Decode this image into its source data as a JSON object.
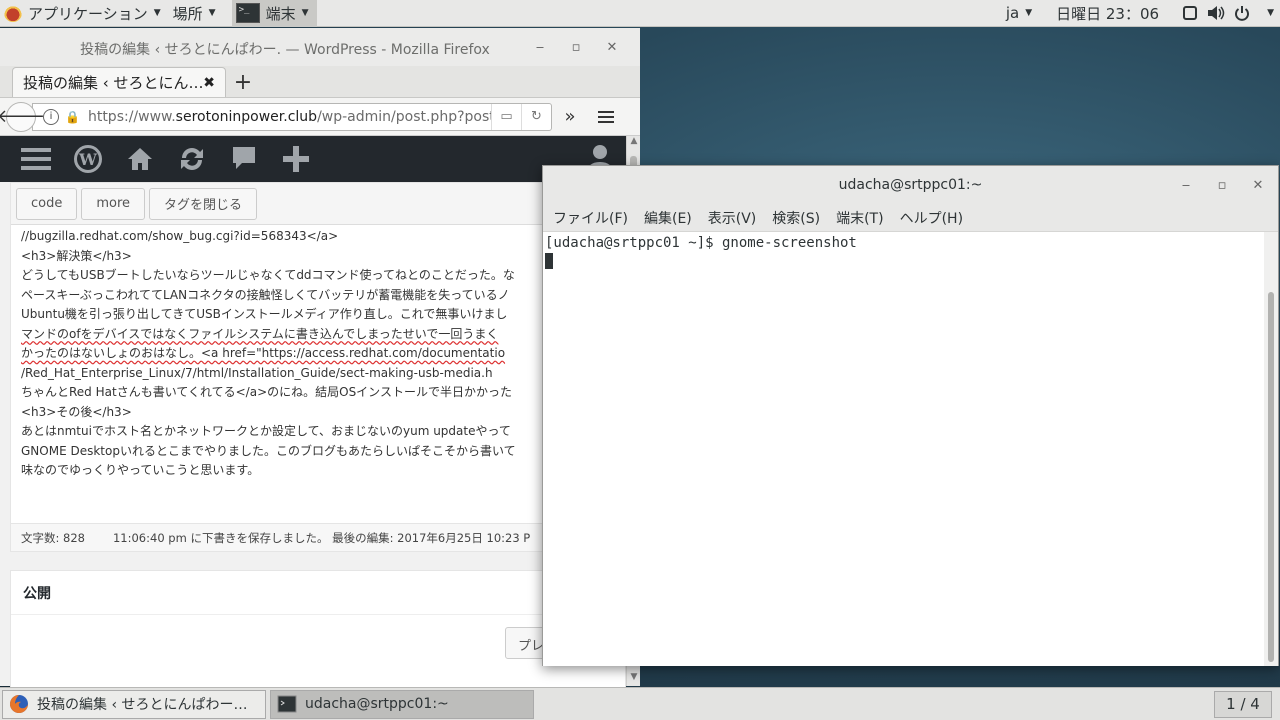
{
  "topbar": {
    "applications": "アプリケーション",
    "places": "場所",
    "active_app": "端末",
    "input_method": "ja",
    "clock": "日曜日 23：06"
  },
  "firefox": {
    "window_title": "投稿の編集 ‹ せろとにんぱわー. — WordPress - Mozilla Firefox",
    "tab_label": "投稿の編集 ‹ せろとにん…",
    "url_prefix": "https://www.",
    "url_domain": "serotoninpower.club",
    "url_path": "/wp-admin/post.php?post"
  },
  "editor": {
    "buttons": [
      "code",
      "more",
      "タグを閉じる"
    ],
    "lines": [
      "//bugzilla.redhat.com/show_bug.cgi?id=568343</a>",
      "<h3>解決策</h3>",
      "どうしてもUSBブートしたいならツールじゃなくてddコマンド使ってねとのことだった。な",
      "ペースキーぶっこわれててLANコネクタの接触怪しくてバッテリが蓄電機能を失っているノ",
      "Ubuntu機を引っ張り出してきてUSBインストールメディア作り直し。これで無事いけまし",
      "マンドのofをデバイスではなくファイルシステムに書き込んでしまったせいで一回うまく",
      "かったのはないしょのおはなし。<a href=\"https://access.redhat.com/documentatio",
      "/Red_Hat_Enterprise_Linux/7/html/Installation_Guide/sect-making-usb-media.h",
      "ちゃんとRed Hatさんも書いてくれてる</a>のにね。結局OSインストールで半日かかった",
      "<h3>その後</h3>",
      "あとはnmtuiでホスト名とかネットワークとか設定して、おまじないのyum updateやって",
      "GNOME Desktopいれるとこまでやりました。このブログもあたらしいぱそこそから書いて",
      "味なのでゆっくりやっていこうと思います。"
    ],
    "word_count": "文字数: 828",
    "save_status": "11:06:40 pm に下書きを保存しました。 最後の編集: 2017年6月25日 10:23 P",
    "publish_title": "公開",
    "preview_label": "プレ"
  },
  "terminal": {
    "title": "udacha@srtppc01:~",
    "menus": [
      "ファイル(F)",
      "編集(E)",
      "表示(V)",
      "検索(S)",
      "端末(T)",
      "ヘルプ(H)"
    ],
    "prompt": "[udacha@srtppc01 ~]$ gnome-screenshot"
  },
  "taskbar": {
    "tasks": [
      "投稿の編集 ‹ せろとにんぱわー…",
      "udacha@srtppc01:~"
    ],
    "workspace": "1 / 4"
  }
}
